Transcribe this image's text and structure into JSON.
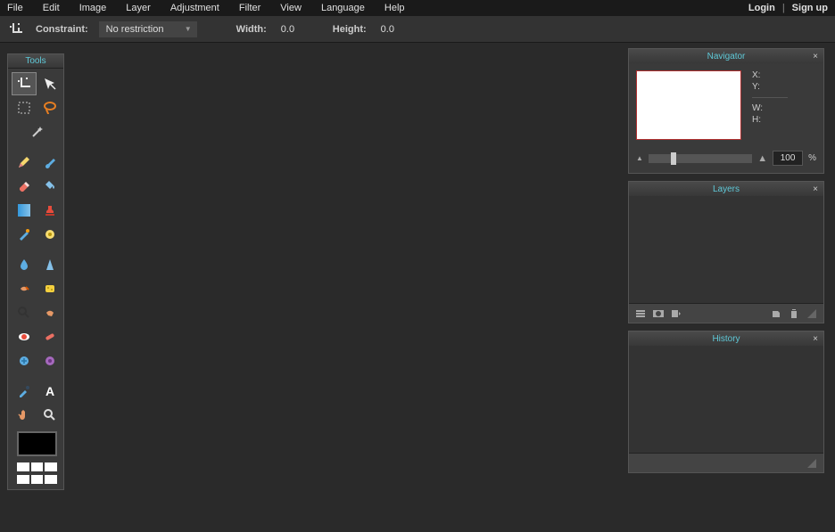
{
  "menubar": {
    "items": [
      "File",
      "Edit",
      "Image",
      "Layer",
      "Adjustment",
      "Filter",
      "View",
      "Language",
      "Help"
    ],
    "login": "Login",
    "signup": "Sign up"
  },
  "toolbar": {
    "constraint_label": "Constraint:",
    "constraint_value": "No restriction",
    "width_label": "Width:",
    "width_value": "0.0",
    "height_label": "Height:",
    "height_value": "0.0"
  },
  "tools_panel": {
    "title": "Tools"
  },
  "navigator": {
    "title": "Navigator",
    "x_label": "X:",
    "y_label": "Y:",
    "w_label": "W:",
    "h_label": "H:",
    "zoom": "100",
    "percent": "%"
  },
  "layers": {
    "title": "Layers"
  },
  "history": {
    "title": "History"
  }
}
